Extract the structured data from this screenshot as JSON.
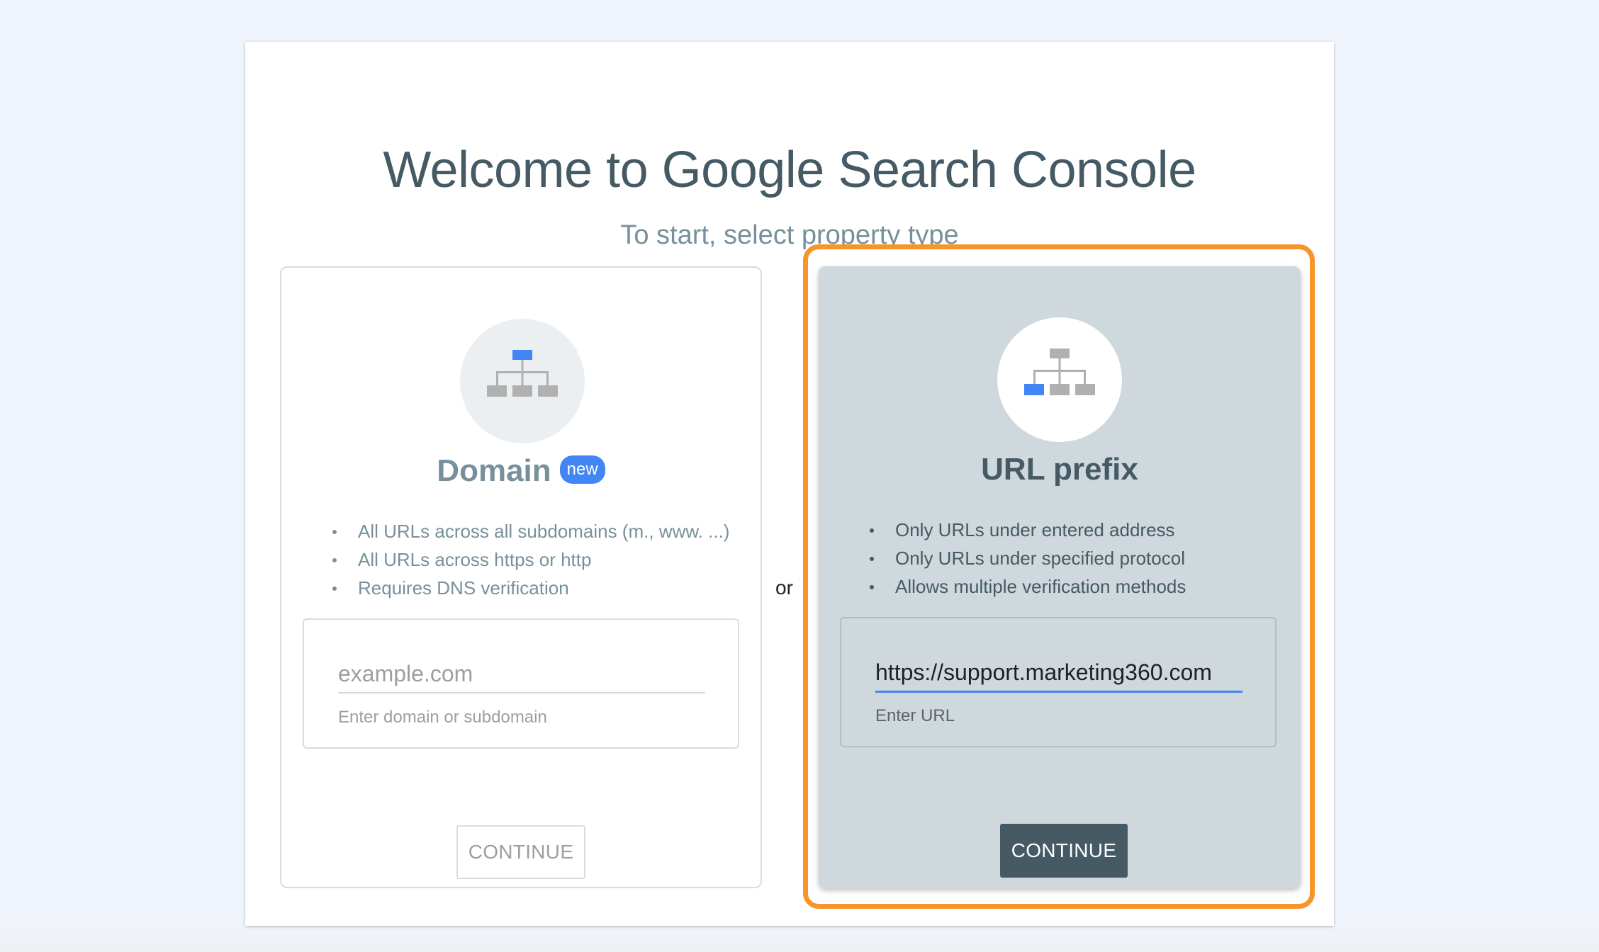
{
  "dialog": {
    "title": "Welcome to Google Search Console",
    "subtitle": "To start, select property type",
    "separator": "or"
  },
  "domain_card": {
    "title": "Domain",
    "badge": "new",
    "bullets": [
      "All URLs across all subdomains (m., www. ...)",
      "All URLs across https or http",
      "Requires DNS verification"
    ],
    "input": {
      "value": "",
      "placeholder": "example.com",
      "hint": "Enter domain or subdomain"
    },
    "button": "CONTINUE",
    "icon": "site-hierarchy-icon"
  },
  "url_prefix_card": {
    "title": "URL prefix",
    "bullets": [
      "Only URLs under entered address",
      "Only URLs under specified protocol",
      "Allows multiple verification methods"
    ],
    "input": {
      "value": "https://support.marketing360.com",
      "placeholder": "",
      "hint": "Enter URL"
    },
    "button": "CONTINUE",
    "icon": "site-hierarchy-icon"
  },
  "colors": {
    "accent_blue": "#4285f4",
    "highlight_orange": "#f6952a",
    "primary_button": "#455a64",
    "selected_card_bg": "#cfd8dc"
  }
}
